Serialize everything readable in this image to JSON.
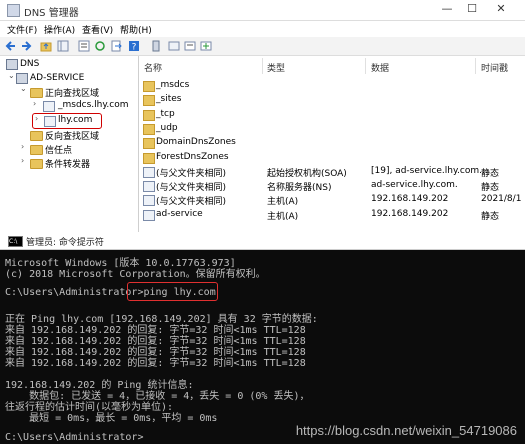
{
  "dns_window": {
    "title": "DNS 管理器",
    "controls": [
      "—",
      "☐",
      "✕"
    ],
    "menu": [
      "文件(F)",
      "操作(A)",
      "查看(V)",
      "帮助(H)"
    ],
    "tree": [
      {
        "label": "DNS",
        "arrow": "",
        "level": 0
      },
      {
        "label": "AD-SERVICE",
        "arrow": "⌄",
        "level": 1
      },
      {
        "label": "正向查找区域",
        "arrow": "⌄",
        "level": 2
      },
      {
        "label": "_msdcs.lhy.com",
        "arrow": "›",
        "level": 3
      },
      {
        "label": "lhy.com",
        "arrow": "›",
        "level": 3,
        "selected": true
      },
      {
        "label": "反向查找区域",
        "arrow": "",
        "level": 2
      },
      {
        "label": "信任点",
        "arrow": "›",
        "level": 2
      },
      {
        "label": "条件转发器",
        "arrow": "›",
        "level": 2
      }
    ],
    "columns": [
      "名称",
      "类型",
      "数据",
      "时间戳"
    ],
    "rows": [
      {
        "name": "_msdcs",
        "type": "",
        "data": "",
        "ts": "",
        "icon": "folder"
      },
      {
        "name": "_sites",
        "type": "",
        "data": "",
        "ts": "",
        "icon": "folder"
      },
      {
        "name": "_tcp",
        "type": "",
        "data": "",
        "ts": "",
        "icon": "folder"
      },
      {
        "name": "_udp",
        "type": "",
        "data": "",
        "ts": "",
        "icon": "folder"
      },
      {
        "name": "DomainDnsZones",
        "type": "",
        "data": "",
        "ts": "",
        "icon": "folder"
      },
      {
        "name": "ForestDnsZones",
        "type": "",
        "data": "",
        "ts": "",
        "icon": "folder"
      },
      {
        "name": "(与父文件夹相同)",
        "type": "起始授权机构(SOA)",
        "data": "[19], ad-service.lhy.com...",
        "ts": "静态",
        "icon": "record"
      },
      {
        "name": "(与父文件夹相同)",
        "type": "名称服务器(NS)",
        "data": "ad-service.lhy.com.",
        "ts": "静态",
        "icon": "record"
      },
      {
        "name": "(与父文件夹相同)",
        "type": "主机(A)",
        "data": "192.168.149.202",
        "ts": "2021/8/1",
        "icon": "record"
      },
      {
        "name": "ad-service",
        "type": "主机(A)",
        "data": "192.168.149.202",
        "ts": "静态",
        "icon": "record"
      }
    ]
  },
  "cmd_window": {
    "title": "管理员: 命令提示符",
    "icon_text": "C:\\",
    "lines": [
      "Microsoft Windows [版本 10.0.17763.973]",
      "(c) 2018 Microsoft Corporation。保留所有权利。",
      "",
      "C:\\Users\\Administrator>ping lhy.com",
      "",
      "正在 Ping lhy.com [192.168.149.202] 具有 32 字节的数据:",
      "来自 192.168.149.202 的回复: 字节=32 时间<1ms TTL=128",
      "来自 192.168.149.202 的回复: 字节=32 时间<1ms TTL=128",
      "来自 192.168.149.202 的回复: 字节=32 时间<1ms TTL=128",
      "来自 192.168.149.202 的回复: 字节=32 时间<1ms TTL=128",
      "",
      "192.168.149.202 的 Ping 统计信息:",
      "    数据包: 已发送 = 4，已接收 = 4，丢失 = 0 (0% 丢失)，",
      "往返行程的估计时间(以毫秒为单位):",
      "    最短 = 0ms，最长 = 0ms，平均 = 0ms",
      "",
      "C:\\Users\\Administrator>"
    ]
  },
  "watermark": "https://blog.csdn.net/weixin_54719086"
}
